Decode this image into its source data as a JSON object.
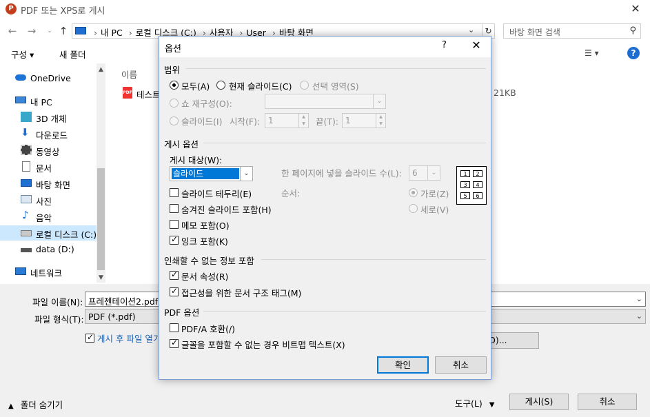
{
  "window": {
    "title": "PDF 또는 XPS로 게시",
    "app_icon": "P"
  },
  "nav": {
    "breadcrumbs": [
      "내 PC",
      "로컬 디스크 (C:)",
      "사용자",
      "User",
      "바탕 화면"
    ],
    "search_placeholder": "바탕 화면 검색"
  },
  "toolbar": {
    "organize": "구성 ▾",
    "new_folder": "새 폴더"
  },
  "sidebar": {
    "items": [
      {
        "label": "OneDrive"
      },
      {
        "label": "내 PC"
      },
      {
        "label": "3D 개체"
      },
      {
        "label": "다운로드"
      },
      {
        "label": "동영상"
      },
      {
        "label": "문서"
      },
      {
        "label": "바탕 화면"
      },
      {
        "label": "사진"
      },
      {
        "label": "음악"
      },
      {
        "label": "로컬 디스크 (C:)"
      },
      {
        "label": "data (D:)"
      },
      {
        "label": "네트워크"
      }
    ]
  },
  "filelist": {
    "header_name": "이름",
    "file_name": "테스트",
    "file_size": "21KB"
  },
  "bottom": {
    "filename_label": "파일 이름(N):",
    "filename_value": "프레젠테이션2.pdf",
    "filetype_label": "파일 형식(T):",
    "filetype_value": "PDF (*.pdf)",
    "open_after": "게시 후 파일 열기",
    "options_button_tail": "O)...",
    "hide_folders": "폴더 숨기기",
    "tools": "도구(L)",
    "publish": "게시(S)",
    "cancel": "취소"
  },
  "options": {
    "title": "옵션",
    "help": "?",
    "range": {
      "header": "범위",
      "all": "모두(A)",
      "current": "현재 슬라이드(C)",
      "selection": "선택 영역(S)",
      "custom_show": "쇼 재구성(O):",
      "slides": "슬라이드(I)",
      "from_label": "시작(F):",
      "from_value": "1",
      "to_label": "끝(T):",
      "to_value": "1"
    },
    "publish": {
      "header": "게시 옵션",
      "what_label": "게시 대상(W):",
      "what_value": "슬라이드",
      "frame": "슬라이드 테두리(E)",
      "hidden": "숨겨진 슬라이드 포함(H)",
      "comments": "메모 포함(O)",
      "ink": "잉크 포함(K)",
      "per_page_label": "한 페이지에 넣을 슬라이드 수(L):",
      "per_page_value": "6",
      "order_label": "순서:",
      "horizontal": "가로(Z)",
      "vertical": "세로(V)",
      "layout_cells": [
        "1",
        "2",
        "3",
        "4",
        "5",
        "6"
      ]
    },
    "nonprint": {
      "header": "인쇄할 수 없는 정보 포함",
      "doc_props": "문서 속성(R)",
      "struct_tags": "접근성을 위한 문서 구조 태그(M)"
    },
    "pdf": {
      "header": "PDF 옵션",
      "pdfa": "PDF/A 호환(/)",
      "bitmap": "글꼴을 포함할 수 없는 경우 비트맵 텍스트(X)"
    },
    "ok": "확인",
    "cancel": "취소"
  }
}
